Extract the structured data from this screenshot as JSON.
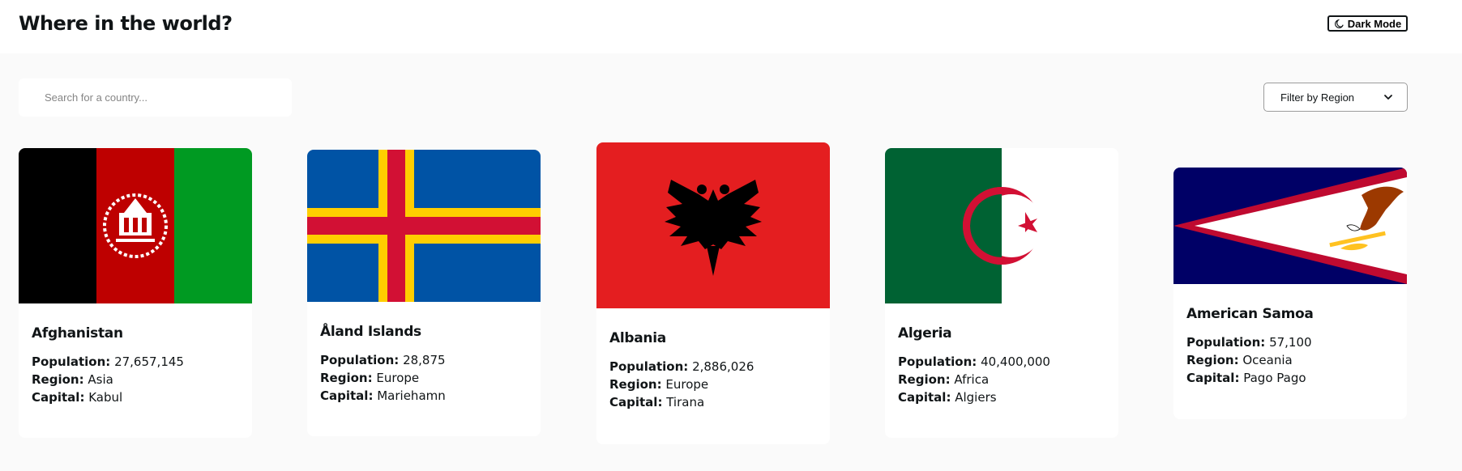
{
  "header": {
    "title": "Where in the world?",
    "theme_toggle_label": "Dark Mode"
  },
  "controls": {
    "search_placeholder": "Search for a country...",
    "filter_label": "Filter by Region"
  },
  "field_labels": {
    "population": "Population:",
    "region": "Region:",
    "capital": "Capital:"
  },
  "countries": [
    {
      "name": "Afghanistan",
      "population": "27,657,145",
      "region": "Asia",
      "capital": "Kabul"
    },
    {
      "name": "Åland Islands",
      "population": "28,875",
      "region": "Europe",
      "capital": "Mariehamn"
    },
    {
      "name": "Albania",
      "population": "2,886,026",
      "region": "Europe",
      "capital": "Tirana"
    },
    {
      "name": "Algeria",
      "population": "40,400,000",
      "region": "Africa",
      "capital": "Algiers"
    },
    {
      "name": "American Samoa",
      "population": "57,100",
      "region": "Oceania",
      "capital": "Pago Pago"
    }
  ],
  "colors": {
    "background": "#fafafa",
    "card": "#ffffff",
    "text": "#111517"
  }
}
